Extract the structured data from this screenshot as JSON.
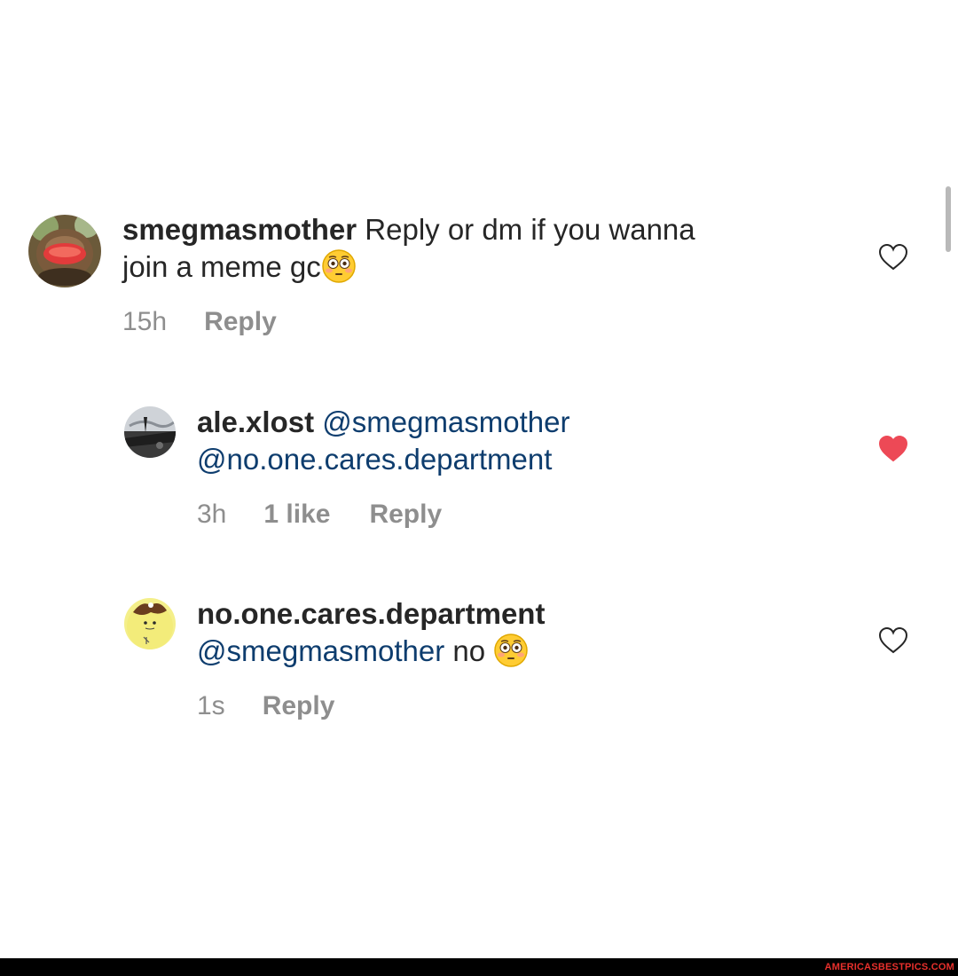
{
  "comments": [
    {
      "username": "smegmasmother",
      "text_line1": " Reply or dm if you wanna",
      "text_line2": "join a meme gc",
      "emoji": "flushed-face",
      "time": "15h",
      "reply_label": "Reply",
      "liked": false
    },
    {
      "username": "ale.xlost",
      "mention1": "@smegmasmother",
      "mention2": "@no.one.cares.department",
      "time": "3h",
      "likes_label": "1 like",
      "reply_label": "Reply",
      "liked": true
    },
    {
      "username": "no.one.cares.department",
      "mention1": "@smegmasmother",
      "text_after": " no ",
      "emoji": "flushed-face",
      "time": "1s",
      "reply_label": "Reply",
      "liked": false
    }
  ],
  "footer": {
    "watermark": "AMERICASBESTPICS.COM"
  },
  "colors": {
    "username": "#262626",
    "mention": "#0e3d6e",
    "meta": "#8e8e8e",
    "liked_heart": "#ed4956",
    "watermark": "#e8302c"
  }
}
